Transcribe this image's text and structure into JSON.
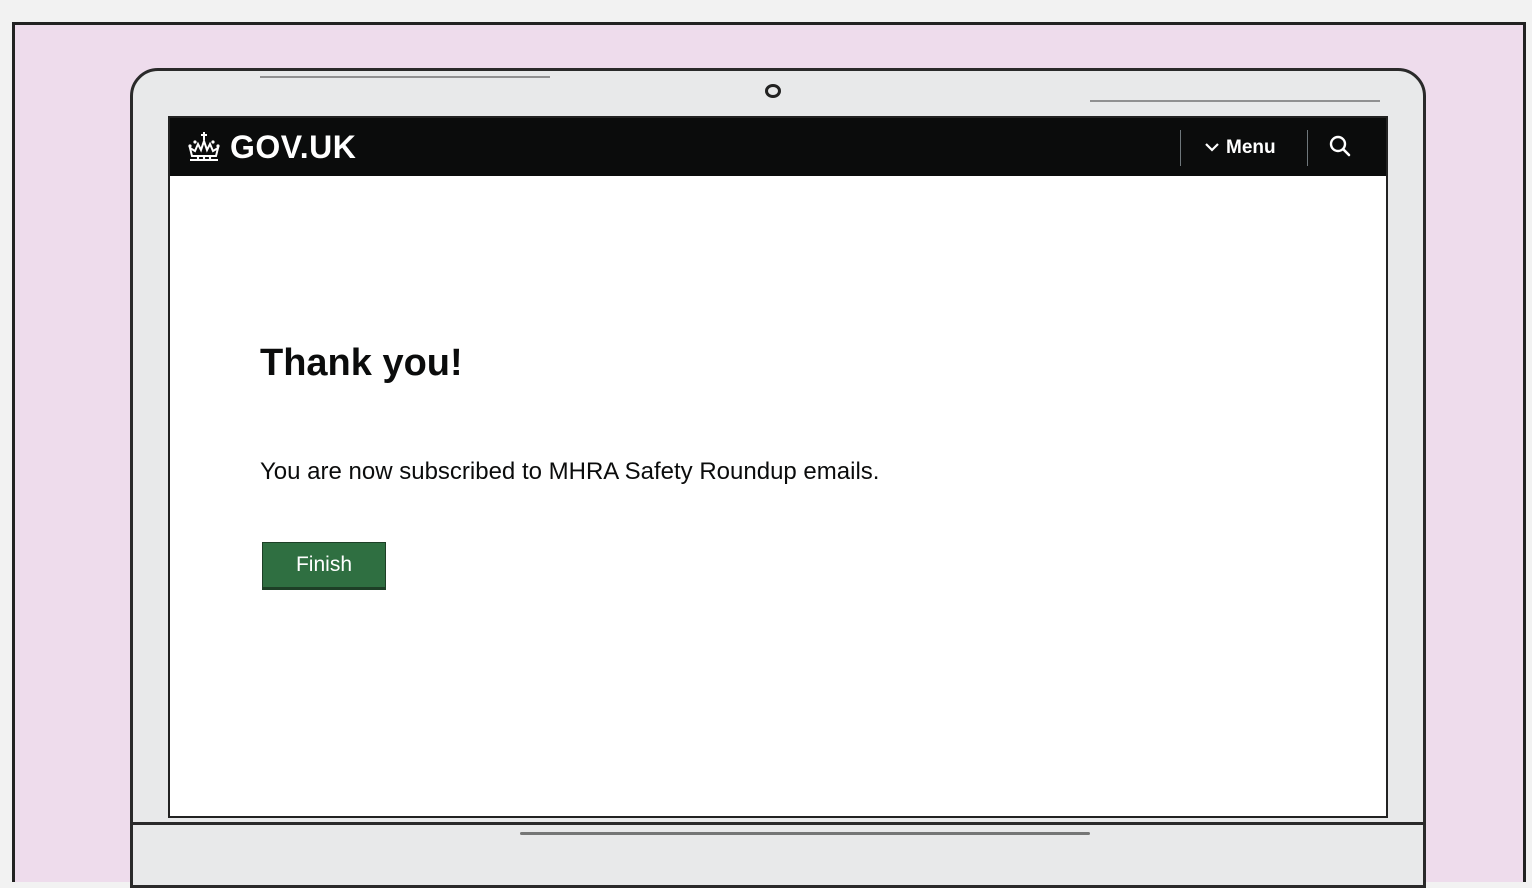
{
  "header": {
    "logo_text": "GOV.UK",
    "menu_label": "Menu",
    "background": "#0b0c0c"
  },
  "icons": {
    "logo": "crown-icon",
    "menu": "chevron-down-icon",
    "search": "search-icon"
  },
  "main": {
    "title": "Thank you!",
    "message": "You are now subscribed to MHRA Safety Roundup emails.",
    "finish_label": "Finish"
  },
  "colors": {
    "frame_background": "#eedcec",
    "button_green": "#2f6f41"
  }
}
